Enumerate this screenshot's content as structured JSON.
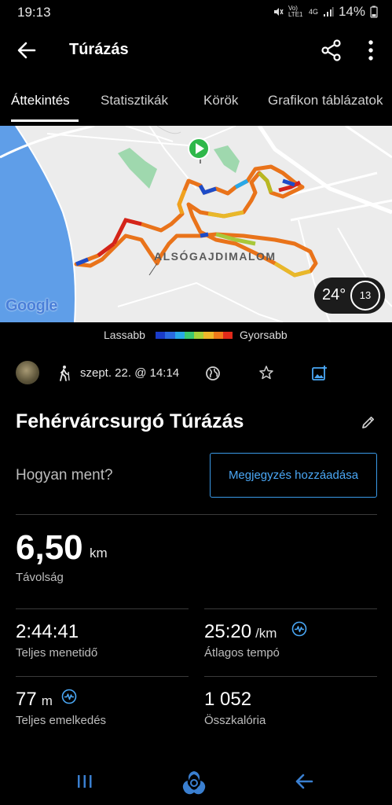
{
  "status_bar": {
    "time": "19:13",
    "network": "Vo) LTE1",
    "signal": "4G",
    "battery": "14%"
  },
  "header": {
    "title": "Túrázás"
  },
  "tabs": [
    {
      "label": "Áttekintés",
      "active": true
    },
    {
      "label": "Statisztikák",
      "active": false
    },
    {
      "label": "Körök",
      "active": false
    },
    {
      "label": "Grafikon táblázatok",
      "active": false
    }
  ],
  "map": {
    "place_label": "ALSÓGAJDIMALOM",
    "provider": "Google",
    "temperature": "24°",
    "wind": "13"
  },
  "legend": {
    "slower": "Lassabb",
    "faster": "Gyorsabb",
    "colors": [
      "#1a3cc8",
      "#2a6ae0",
      "#28a8e8",
      "#3cc870",
      "#a8d23a",
      "#f0b82a",
      "#f07a1a",
      "#e02a1a"
    ]
  },
  "meta": {
    "date": "szept. 22. @ 14:14"
  },
  "activity": {
    "name": "Fehérvárcsurgó Túrázás",
    "prompt": "Hogyan ment?",
    "note_button": "Megjegyzés hozzáadása"
  },
  "stats": {
    "distance": {
      "value": "6,50",
      "unit": "km",
      "label": "Távolság"
    },
    "total_time": {
      "value": "2:44:41",
      "label": "Teljes menetidő"
    },
    "avg_pace": {
      "value": "25:20",
      "unit": "/km",
      "label": "Átlagos tempó"
    },
    "elevation_gain": {
      "value": "77",
      "unit": "m",
      "label": "Teljes emelkedés"
    },
    "calories": {
      "value": "1 052",
      "label": "Összkalória"
    }
  },
  "colors": {
    "accent": "#4aa7f5",
    "route_start": "#2fb84a",
    "water": "#5f9ee8"
  }
}
